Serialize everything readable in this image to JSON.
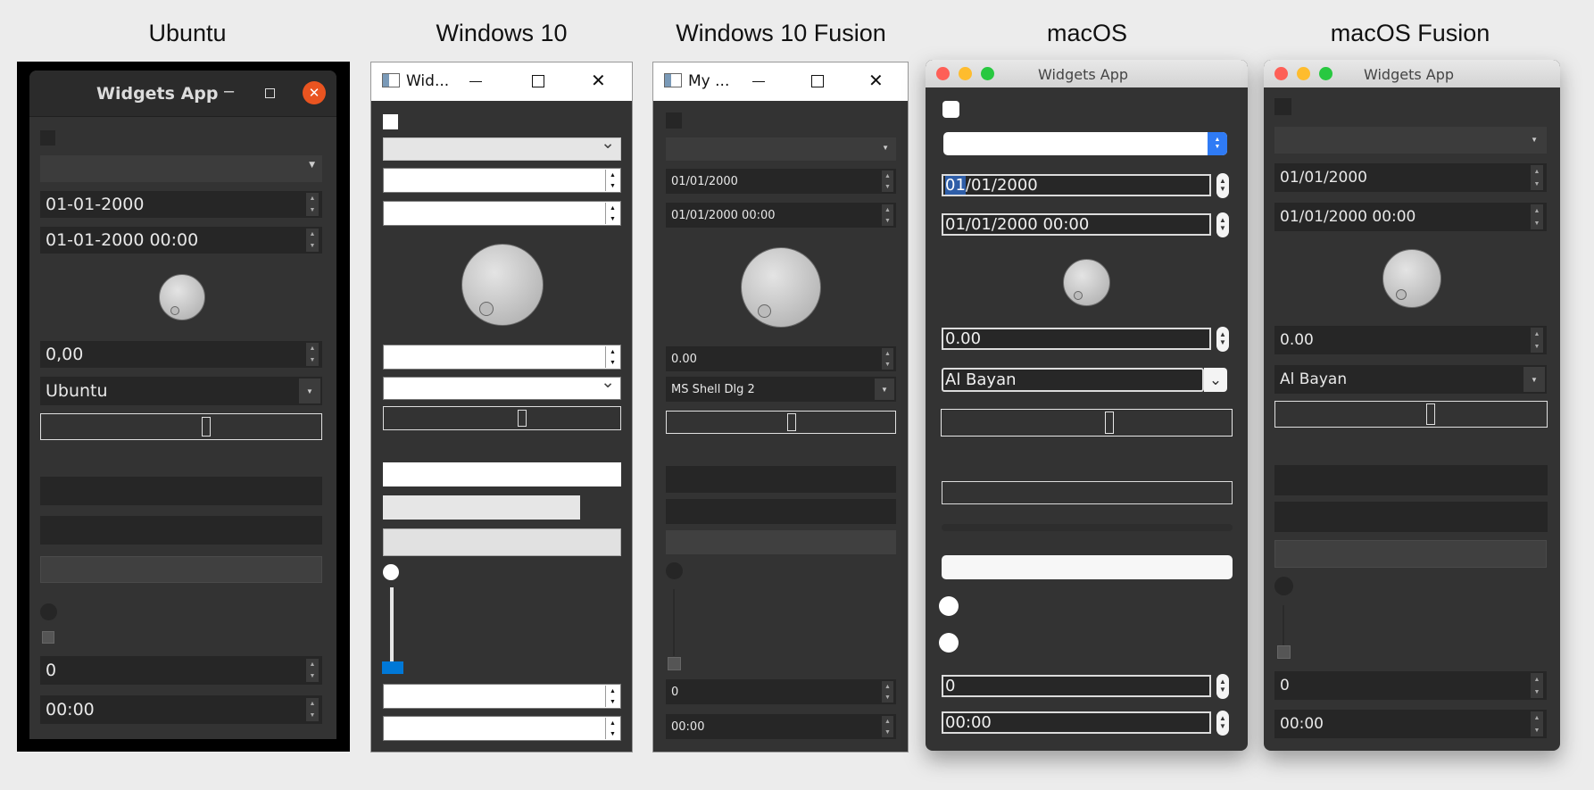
{
  "headers": [
    "Ubuntu",
    "Windows 10",
    "Windows 10 Fusion",
    "macOS",
    "macOS Fusion"
  ],
  "ubuntu": {
    "title": "Widgets App",
    "date": "01-01-2000",
    "datetime": "01-01-2000 00:00",
    "double": "0,00",
    "font": "Ubuntu",
    "spin": "0",
    "time": "00:00"
  },
  "win10": {
    "title": "Wid..."
  },
  "win10fusion": {
    "title": "My ...",
    "date": "01/01/2000",
    "datetime": "01/01/2000 00:00",
    "double": "0.00",
    "font": "MS Shell Dlg 2",
    "spin": "0",
    "time": "00:00"
  },
  "macos": {
    "title": "Widgets App",
    "date_sel": "01",
    "date_rest": "/01/2000",
    "datetime": "01/01/2000 00:00",
    "double": "0.00",
    "font": "Al Bayan",
    "spin": "0",
    "time": "00:00"
  },
  "macosfusion": {
    "title": "Widgets App",
    "date": "01/01/2000",
    "datetime": "01/01/2000 00:00",
    "double": "0.00",
    "font": "Al Bayan",
    "spin": "0",
    "time": "00:00"
  },
  "icons": {
    "minimize": "–",
    "maximize": "☐",
    "close": "✕",
    "chevron": "⌄",
    "up": "▲",
    "down": "▼"
  },
  "colors": {
    "ubuntu_close": "#e95420",
    "mac_red": "#fe5f57",
    "mac_yellow": "#febc2e",
    "mac_green": "#28c840",
    "win_accent": "#0078d7",
    "mac_accent": "#2f7bf5"
  }
}
